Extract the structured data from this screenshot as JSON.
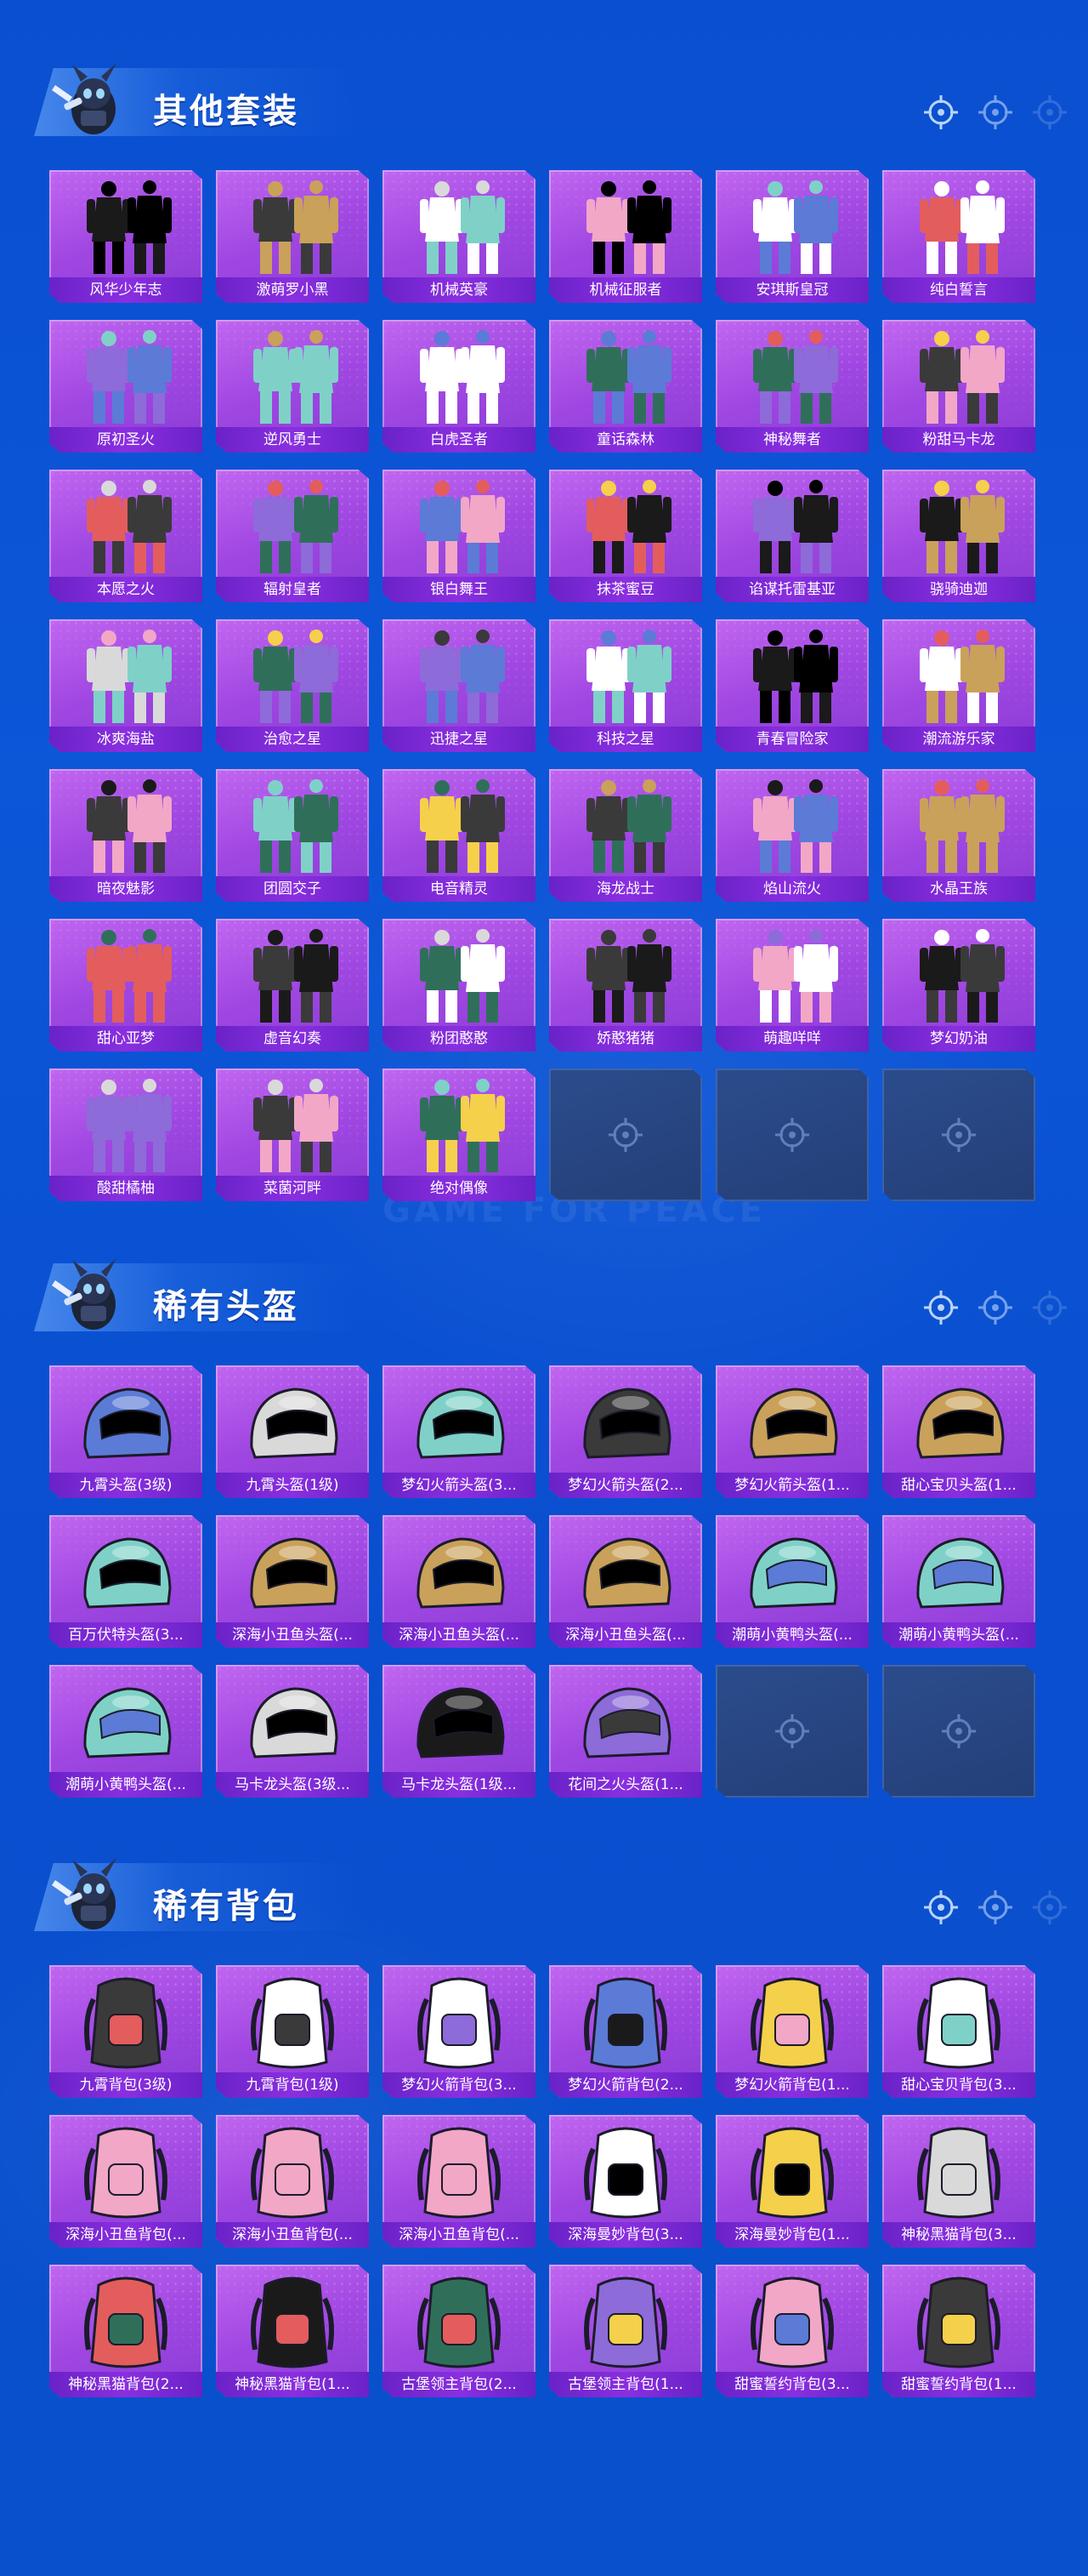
{
  "colors": {
    "background": "#0b57d8",
    "card_purple": "#a047e2",
    "label_bar": "#7a28d6",
    "empty_card": "#284684"
  },
  "watermark": "GAME FOR PEACE",
  "sections": [
    {
      "title": "其他套装",
      "kind": "outfit",
      "items": [
        "风华少年志",
        "激萌罗小黑",
        "机械英豪",
        "机械征服者",
        "安琪斯皇冠",
        "纯白誓言",
        "原初圣火",
        "逆风勇士",
        "白虎圣者",
        "童话森林",
        "神秘舞者",
        "粉甜马卡龙",
        "本愿之火",
        "辐射皇者",
        "银白舞王",
        "抹茶蜜豆",
        "谄谋托雷基亚",
        "骁骑迪迦",
        "冰爽海盐",
        "治愈之星",
        "迅捷之星",
        "科技之星",
        "青春冒险家",
        "潮流游乐家",
        "暗夜魅影",
        "团圆交子",
        "电音精灵",
        "海龙战士",
        "焰山流火",
        "水晶王族",
        "甜心亚梦",
        "虚音幻奏",
        "粉团憨憨",
        "娇憨猪猪",
        "萌趣咩咩",
        "梦幻奶油",
        "酸甜橘柚",
        "菜菌河畔",
        "绝对偶像"
      ],
      "empty_slots": 3
    },
    {
      "title": "稀有头盔",
      "kind": "helmet",
      "items": [
        "九霄头盔(3级)",
        "九霄头盔(1级)",
        "梦幻火箭头盔(3...",
        "梦幻火箭头盔(2...",
        "梦幻火箭头盔(1...",
        "甜心宝贝头盔(1...",
        "百万伏特头盔(3...",
        "深海小丑鱼头盔(...",
        "深海小丑鱼头盔(...",
        "深海小丑鱼头盔(...",
        "潮萌小黄鸭头盔(...",
        "潮萌小黄鸭头盔(...",
        "潮萌小黄鸭头盔(...",
        "马卡龙头盔(3级...",
        "马卡龙头盔(1级...",
        "花间之火头盔(1..."
      ],
      "empty_slots": 2
    },
    {
      "title": "稀有背包",
      "kind": "backpack",
      "items": [
        "九霄背包(3级)",
        "九霄背包(1级)",
        "梦幻火箭背包(3...",
        "梦幻火箭背包(2...",
        "梦幻火箭背包(1...",
        "甜心宝贝背包(3...",
        "深海小丑鱼背包(...",
        "深海小丑鱼背包(...",
        "深海小丑鱼背包(...",
        "深海曼妙背包(3...",
        "深海曼妙背包(1...",
        "神秘黑猫背包(3...",
        "神秘黑猫背包(2...",
        "神秘黑猫背包(1...",
        "古堡领主背包(2...",
        "古堡领主背包(1...",
        "甜蜜誓约背包(3...",
        "甜蜜誓约背包(1..."
      ],
      "empty_slots": 0
    }
  ]
}
